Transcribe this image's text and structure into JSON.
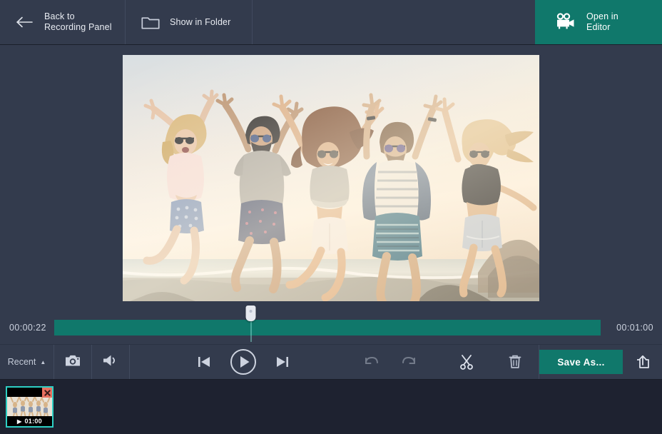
{
  "header": {
    "back": {
      "label": "Back to\nRecording Panel",
      "icon": "arrow-left-icon"
    },
    "show_in_folder": {
      "label": "Show in Folder",
      "icon": "folder-icon"
    },
    "open_in_editor": {
      "label": "Open in\nEditor",
      "icon": "movie-camera-icon",
      "accent": "#10786b"
    }
  },
  "preview": {
    "alt": "Five friends jumping on a beach at sunset",
    "background": "#000000"
  },
  "timeline": {
    "current_time": "00:00:22",
    "total_time": "00:01:00",
    "progress_percent": 36,
    "track_color": "#10786b",
    "playhead_color": "#7fd8cc"
  },
  "controls": {
    "recent": {
      "label": "Recent",
      "caret": "▲"
    },
    "snapshot": {
      "icon": "camera-icon"
    },
    "volume": {
      "icon": "speaker-icon"
    },
    "previous": {
      "icon": "skip-previous-icon"
    },
    "play": {
      "icon": "play-icon"
    },
    "next": {
      "icon": "skip-next-icon"
    },
    "undo": {
      "icon": "undo-icon",
      "enabled": false
    },
    "redo": {
      "icon": "redo-icon",
      "enabled": false
    },
    "cut": {
      "icon": "scissors-icon",
      "enabled": true
    },
    "delete": {
      "icon": "trash-icon",
      "enabled": true
    },
    "save_as": {
      "label": "Save As...",
      "accent": "#10786b"
    },
    "share": {
      "icon": "share-export-icon"
    }
  },
  "filmstrip": {
    "clips": [
      {
        "duration": "01:00",
        "play_glyph": "▶",
        "selected": true,
        "border_color": "#2ecfc4",
        "close_icon": "close-icon",
        "close_color": "#e8705f"
      }
    ]
  }
}
